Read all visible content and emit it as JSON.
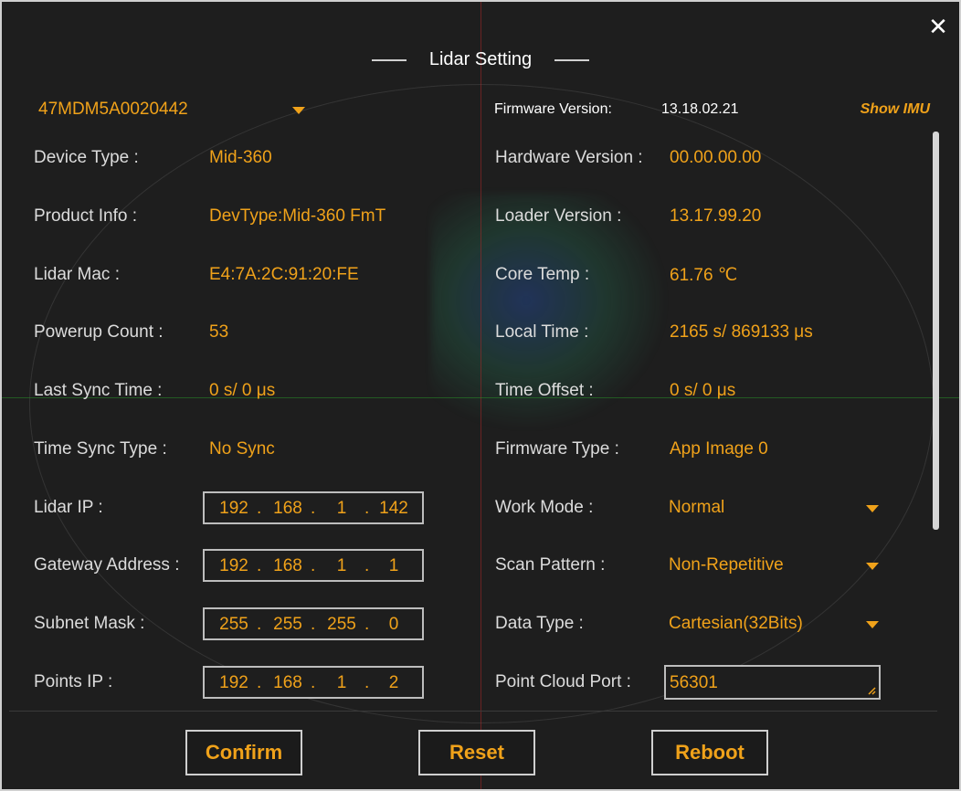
{
  "dialog": {
    "title": "Lidar Setting",
    "close_icon": "close-icon",
    "close_glyph": "✕"
  },
  "device": {
    "selected": "47MDM5A0020442"
  },
  "firmware": {
    "label": "Firmware Version:",
    "value": "13.18.02.21",
    "show_imu": "Show IMU"
  },
  "left": {
    "device_type": {
      "label": "Device Type :",
      "value": "Mid-360"
    },
    "product_info": {
      "label": "Product Info :",
      "value": "DevType:Mid-360 FmT"
    },
    "lidar_mac": {
      "label": "Lidar Mac :",
      "value": "E4:7A:2C:91:20:FE"
    },
    "powerup_count": {
      "label": "Powerup Count :",
      "value": "53"
    },
    "last_sync_time": {
      "label": "Last Sync Time :",
      "value": "0 s/ 0 μs"
    },
    "time_sync_type": {
      "label": "Time Sync Type :",
      "value": "No Sync"
    },
    "lidar_ip": {
      "label": "Lidar IP :",
      "octets": [
        "192",
        "168",
        "1",
        "142"
      ]
    },
    "gateway": {
      "label": "Gateway Address :",
      "octets": [
        "192",
        "168",
        "1",
        "1"
      ]
    },
    "subnet": {
      "label": "Subnet Mask :",
      "octets": [
        "255",
        "255",
        "255",
        "0"
      ]
    },
    "points_ip": {
      "label": "Points IP :",
      "octets": [
        "192",
        "168",
        "1",
        "2"
      ]
    }
  },
  "right": {
    "hardware_version": {
      "label": "Hardware Version :",
      "value": "00.00.00.00"
    },
    "loader_version": {
      "label": "Loader Version :",
      "value": "13.17.99.20"
    },
    "core_temp": {
      "label": "Core Temp :",
      "value": "61.76 ℃"
    },
    "local_time": {
      "label": "Local Time :",
      "value": "2165 s/ 869133 μs"
    },
    "time_offset": {
      "label": "Time Offset :",
      "value": "0 s/ 0 μs"
    },
    "firmware_type": {
      "label": "Firmware Type :",
      "value": "App Image 0"
    },
    "work_mode": {
      "label": "Work Mode :",
      "value": "Normal"
    },
    "scan_pattern": {
      "label": "Scan Pattern :",
      "value": "Non-Repetitive"
    },
    "data_type": {
      "label": "Data Type :",
      "value": "Cartesian(32Bits)"
    },
    "point_cloud_port": {
      "label": "Point Cloud Port :",
      "value": "56301"
    }
  },
  "buttons": {
    "confirm": "Confirm",
    "reset": "Reset",
    "reboot": "Reboot"
  },
  "colors": {
    "accent": "#f0a21a",
    "label": "#dcdcdc",
    "background": "#1e1e1e",
    "border": "#cfcfcf"
  }
}
